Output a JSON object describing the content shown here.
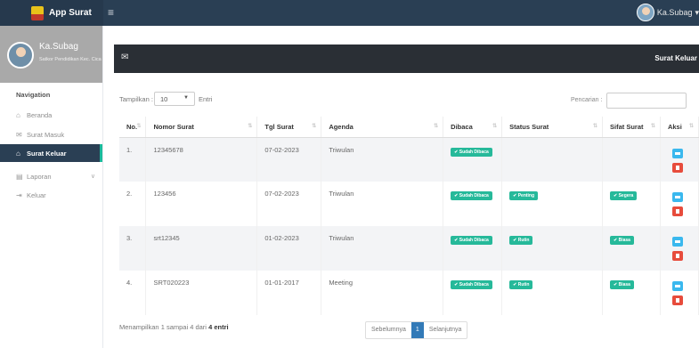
{
  "app": {
    "title": "App Surat"
  },
  "topbar": {
    "menu_icon": "hamburger-icon",
    "user_name": "Ka.Subag"
  },
  "profile": {
    "name": "Ka.Subag",
    "subtitle": "Satkor Pendidikan Kec. Cica"
  },
  "nav": {
    "title": "Navigation",
    "items": [
      {
        "label": "Beranda",
        "icon": "home-icon"
      },
      {
        "label": "Surat Masuk",
        "icon": "mail-icon"
      },
      {
        "label": "Surat Keluar",
        "icon": "outbox-icon"
      },
      {
        "label": "Laporan",
        "icon": "report-icon"
      },
      {
        "label": "Keluar",
        "icon": "logout-icon"
      }
    ]
  },
  "panel": {
    "title": "Surat Keluar",
    "icon": "envelope-icon"
  },
  "length": {
    "label": "Tampilkan :",
    "value": "10",
    "after": "Entri"
  },
  "search": {
    "label": "Pencarian :"
  },
  "table": {
    "headers": [
      "No.",
      "Nomor Surat",
      "Tgl Surat",
      "Agenda",
      "Dibaca",
      "Status Surat",
      "Sifat Surat",
      "Aksi"
    ],
    "rows": [
      {
        "no": "1.",
        "nomor": "12345678",
        "tgl": "07-02-2023",
        "agenda": "Triwulan",
        "dibaca": "✔ Sudah Dibaca",
        "status": "",
        "sifat": ""
      },
      {
        "no": "2.",
        "nomor": "123456",
        "tgl": "07-02-2023",
        "agenda": "Triwulan",
        "dibaca": "✔ Sudah Dibaca",
        "status": "✔ Penting",
        "sifat": "✔ Segera"
      },
      {
        "no": "3.",
        "nomor": "srt12345",
        "tgl": "01-02-2023",
        "agenda": "Triwulan",
        "dibaca": "✔ Sudah Dibaca",
        "status": "✔ Rutin",
        "sifat": "✔ Biasa"
      },
      {
        "no": "4.",
        "nomor": "SRT020223",
        "tgl": "01-01-2017",
        "agenda": "Meeting",
        "dibaca": "✔ Sudah Dibaca",
        "status": "✔ Rutin",
        "sifat": "✔ Biasa"
      }
    ]
  },
  "footer": {
    "info_prefix": "Menampilkan 1 sampai 4 dari",
    "info_total": "4 entri",
    "prev": "Sebelumnya",
    "page": "1",
    "next": "Selanjutnya"
  },
  "colors": {
    "topbar": "#2a3f54",
    "badge": "#26b99a",
    "edit": "#3ab8ee",
    "delete": "#e74c3c",
    "pager_active": "#337ab7"
  }
}
